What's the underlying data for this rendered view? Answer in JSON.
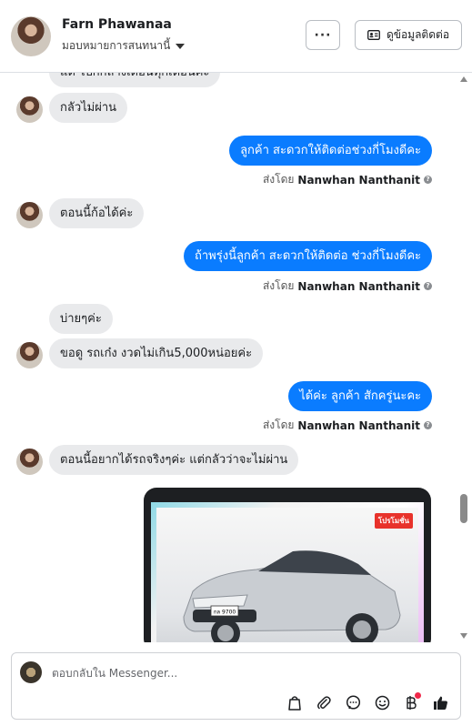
{
  "header": {
    "name": "Farn Phawanaa",
    "assign_label": "มอบหมายการสนทนานี้",
    "more_label": "···",
    "contact_label": "ดูข้อมูลติดต่อ"
  },
  "messages": {
    "partial_top": "แต่ ไปกกลางเดือนทุกเดือนค่ะ",
    "m1": "กลัวไม่ผ่าน",
    "m2": "ลูกค้า สะดวกให้ติดต่อช่วงกี่โมงดีคะ",
    "sent_prefix": "ส่งโดย",
    "sender": "Nanwhan Nanthanit",
    "m3": "ตอนนี้ก้อได้ค่ะ",
    "m4": "ถ้าพรุ่งนี้ลูกค้า สะดวกให้ติดต่อ ช่วงกี่โมงดีคะ",
    "m5": "บ่ายๆค่ะ",
    "m6": "ขอดู รถเก๋ง งวดไม่เกิน5,000หน่อยค่ะ",
    "m7": "ได้ค่ะ  ลูกค้า สักครู่นะคะ",
    "m8": "ตอนนี้อยากได้รถจริงๆค่ะ แต่กลัวว่าจะไม่ผ่าน",
    "promo_badge": "โปรโมชั่น",
    "plate": "กล 9700"
  },
  "composer": {
    "placeholder": "ตอบกลับใน Messenger..."
  },
  "icons": [
    "avatar",
    "caret-down-icon",
    "contact-card-icon",
    "info-icon",
    "bag-icon",
    "attachment-icon",
    "chat-icon",
    "emoji-icon",
    "baht-icon",
    "thumbs-up-icon"
  ],
  "colors": {
    "accent": "#0a7cff",
    "bubble_in": "#e9eaec",
    "badge_red": "#e8322b"
  }
}
